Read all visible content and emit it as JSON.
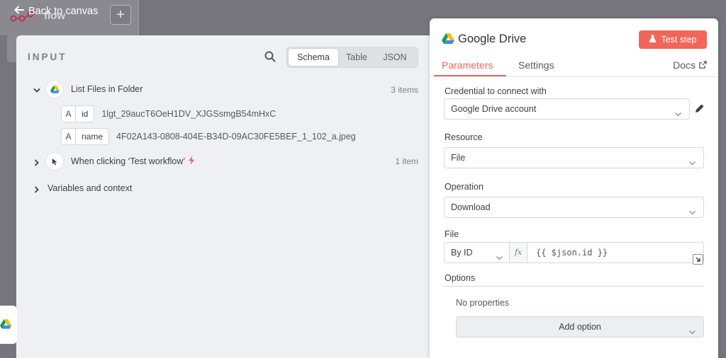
{
  "canvas": {
    "back_label": "Back to canvas",
    "title_partial": "flow",
    "add_button": "+"
  },
  "input": {
    "title": "INPUT",
    "view_options": [
      "Schema",
      "Table",
      "JSON"
    ],
    "active_view": "Schema",
    "tree": [
      {
        "label": "List Files in Folder",
        "count": "3 items",
        "expanded": true,
        "fields": [
          {
            "type": "A",
            "name": "id",
            "value": "1lgt_29aucT6OeH1DV_XJGSsmgB54mHxC"
          },
          {
            "type": "A",
            "name": "name",
            "value": "4F02A143-0808-404E-B34D-09AC30FE5BEF_1_102_a.jpeg"
          }
        ]
      },
      {
        "label": "When clicking ‘Test workflow’",
        "count": "1 item",
        "expanded": false
      },
      {
        "label": "Variables and context",
        "expanded": false
      }
    ]
  },
  "panel": {
    "title": "Google Drive",
    "test_step_label": "Test step",
    "tabs": [
      "Parameters",
      "Settings"
    ],
    "active_tab": "Parameters",
    "docs_label": "Docs",
    "fields": {
      "credential_label": "Credential to connect with",
      "credential_value": "Google Drive account",
      "resource_label": "Resource",
      "resource_value": "File",
      "operation_label": "Operation",
      "operation_value": "Download",
      "file_label": "File",
      "file_mode": "By ID",
      "fx_label": "fx",
      "file_expression": "{{ $json.id }}",
      "options_label": "Options",
      "no_properties": "No properties",
      "add_option_label": "Add option"
    }
  },
  "colors": {
    "accent": "#f1665a",
    "panel_bg": "#ffffff",
    "input_bg": "#eff0f3",
    "canvas_bg": "#76757d"
  }
}
